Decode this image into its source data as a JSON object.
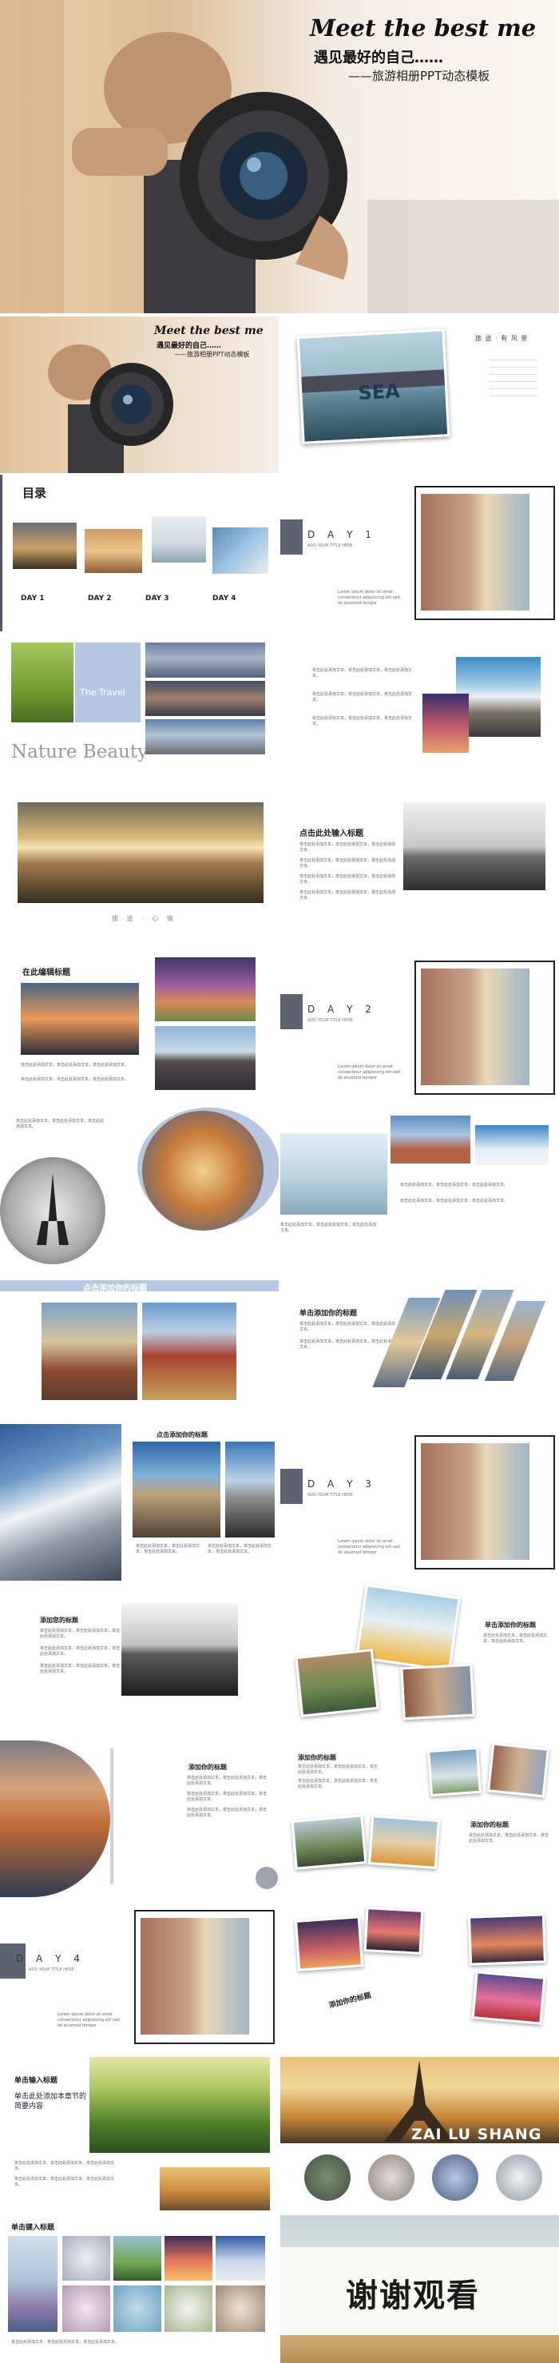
{
  "cover": {
    "title_en": "Meet the best me",
    "title_cn": "遇见最好的自己……",
    "subtitle": "——旅游相册PPT动态模板"
  },
  "s2": {
    "title_en": "Meet the best me",
    "title_cn": "遇见最好的自己……",
    "subtitle": "——旅游相册PPT动态模板"
  },
  "s3": {
    "sea": "SEA",
    "poem_title": "旅 途 · 有 风 景",
    "poem": [
      "",
      "",
      "",
      "",
      "",
      "",
      ""
    ]
  },
  "toc": {
    "title": "目录",
    "sub": "",
    "items": [
      "DAY 1",
      "DAY 2",
      "DAY 3",
      "DAY 4"
    ]
  },
  "day1": {
    "day": "D A Y  1",
    "sub": "ADD YOUR TITLE HERE",
    "body": "Lorem ipsum dolor sit amet consectetur adipisicing elit sed do eiusmod tempor"
  },
  "travel": {
    "tag": "The Travel",
    "nature": "Nature Beauty"
  },
  "para": "单击此处添加文本，单击此处添加文本，单击此处添加文本。",
  "s8": {
    "footer": "旅 途 · 心 情"
  },
  "s9": {
    "title": "点击此处输入标题"
  },
  "s10": {
    "title": "在此编辑标题"
  },
  "day2": {
    "day": "D A Y  2",
    "sub": "ADD YOUR TITLE HERE",
    "body": "Lorem ipsum dolor sit amet consectetur adipisicing elit sed do eiusmod tempor"
  },
  "s14": {
    "title": "点击添加你的标题"
  },
  "s15": {
    "title": "单击添加你的标题"
  },
  "s16": {
    "title": "点击添加你的标题"
  },
  "day3": {
    "day": "D A Y  3",
    "sub": "ADD YOUR TITLE HERE",
    "body": "Lorem ipsum dolor sit amet consectetur adipisicing elit sed do eiusmod tempor"
  },
  "s18": {
    "title": "添加您的标题"
  },
  "s19": {
    "title": "单击添加你的标题"
  },
  "s20": {
    "title": "添加你的标题"
  },
  "s21": {
    "title": "添加你的标题",
    "title2": "添加你的标题"
  },
  "day4": {
    "day": "D A Y  4",
    "sub": "ADD YOUR TITLE HERE",
    "body": "Lorem ipsum dolor sit amet consectetur adipisicing elit sed do eiusmod tempor"
  },
  "s23": {
    "title": "添加你的标题"
  },
  "s24": {
    "title": "单击输入标题",
    "subtitle": "单击此处添加本章节的简要内容"
  },
  "s25": {
    "brand": "ZAI LU SHANG"
  },
  "s26": {
    "title": "单击键入标题"
  },
  "end": {
    "text": "谢谢观看"
  }
}
